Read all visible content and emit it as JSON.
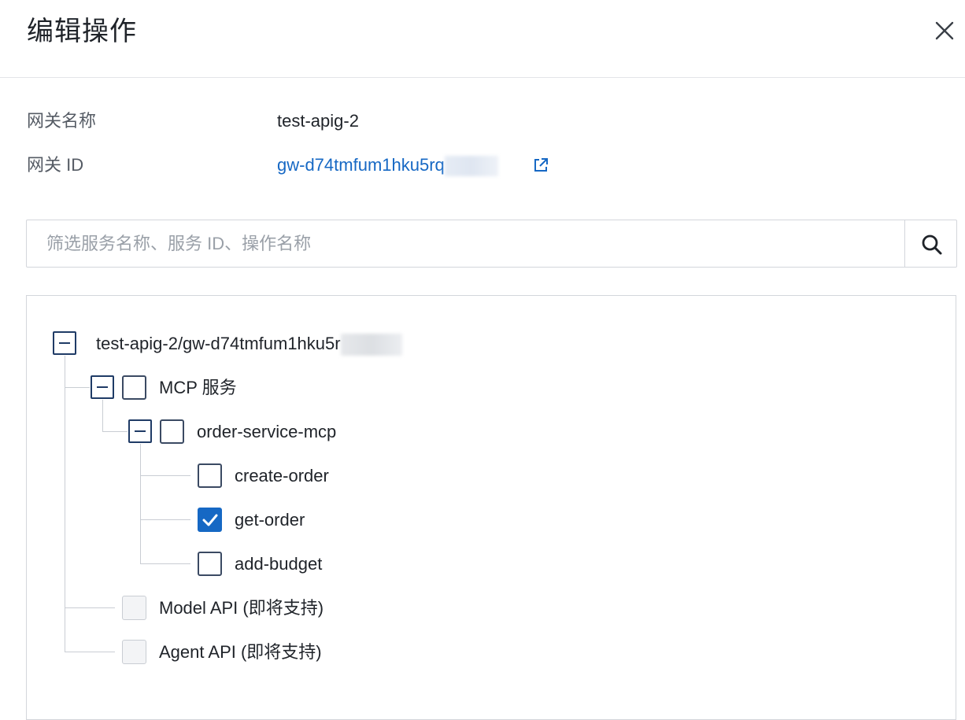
{
  "dialog": {
    "title": "编辑操作",
    "close_icon": "close-icon"
  },
  "info": {
    "gateway_name_label": "网关名称",
    "gateway_name_value": "test-apig-2",
    "gateway_id_label": "网关 ID",
    "gateway_id_value": "gw-d74tmfum1hku5rq",
    "external_link_icon": "external-link-icon"
  },
  "search": {
    "placeholder": "筛选服务名称、服务 ID、操作名称",
    "value": "",
    "icon": "search-icon"
  },
  "tree": {
    "root": {
      "label": "test-apig-2/gw-d74tmfum1hku5r",
      "expanded": true
    },
    "mcp": {
      "label": "MCP 服务",
      "expanded": true,
      "checked": false
    },
    "service": {
      "label": "order-service-mcp",
      "expanded": true,
      "checked": false
    },
    "operations": [
      {
        "label": "create-order",
        "checked": false
      },
      {
        "label": "get-order",
        "checked": true
      },
      {
        "label": "add-budget",
        "checked": false
      }
    ],
    "model_api": {
      "label": "Model API (即将支持)",
      "disabled": true
    },
    "agent_api": {
      "label": "Agent API (即将支持)",
      "disabled": true
    }
  },
  "colors": {
    "accent": "#1668c4",
    "tree_line": "#c9cdd3",
    "border": "#d3d6db"
  }
}
